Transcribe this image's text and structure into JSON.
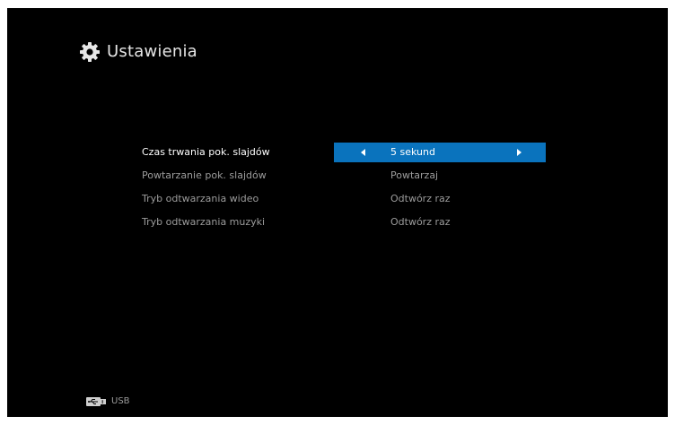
{
  "header": {
    "icon": "gear-icon",
    "title": "Ustawienia"
  },
  "menu": {
    "items": [
      {
        "label": "Czas trwania pok. slajdów",
        "value": "5 sekund",
        "selected": true
      },
      {
        "label": "Powtarzanie pok. slajdów",
        "value": "Powtarzaj",
        "selected": false
      },
      {
        "label": "Tryb odtwarzania wideo",
        "value": "Odtwórz raz",
        "selected": false
      },
      {
        "label": "Tryb odtwarzania muzyki",
        "value": "Odtwórz raz",
        "selected": false
      }
    ]
  },
  "footer": {
    "icon": "usb-icon",
    "source_label": "USB"
  },
  "colors": {
    "background": "#000000",
    "highlight": "#0a73bd",
    "text_active": "#ffffff",
    "text_inactive": "#9c9c9c"
  }
}
